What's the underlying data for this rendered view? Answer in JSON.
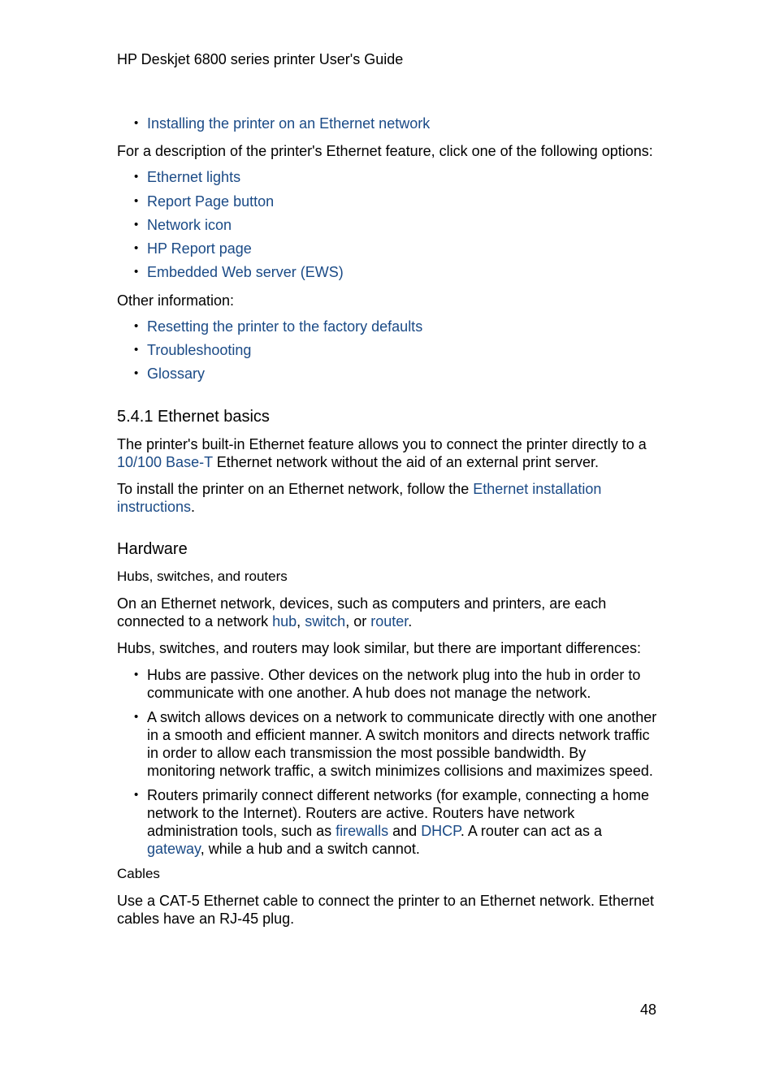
{
  "header": {
    "title": "HP Deskjet 6800 series printer User's Guide"
  },
  "top_links": [
    {
      "label": "Installing the printer on an Ethernet network"
    }
  ],
  "feature_intro": "For a description of the printer's Ethernet feature, click one of the following options:",
  "feature_links": [
    {
      "label": "Ethernet lights"
    },
    {
      "label": "Report Page button"
    },
    {
      "label": "Network icon"
    },
    {
      "label": "HP Report page"
    },
    {
      "label": "Embedded Web server (EWS)"
    }
  ],
  "other_intro": "Other information:",
  "other_links": [
    {
      "label": "Resetting the printer to the factory defaults"
    },
    {
      "label": "Troubleshooting"
    },
    {
      "label": "Glossary"
    }
  ],
  "section": {
    "heading": "5.4.1  Ethernet basics",
    "para1": {
      "pre": "The printer's built-in Ethernet feature allows you to connect the printer directly to a ",
      "link": "10/100 Base-T",
      "post": " Ethernet network without the aid of an external print server."
    },
    "para2": {
      "pre": "To install the printer on an Ethernet network, follow the ",
      "link": "Ethernet installation instructions",
      "post": "."
    }
  },
  "hardware": {
    "heading": "Hardware",
    "subheading": "Hubs, switches, and routers",
    "para1": {
      "pre": "On an Ethernet network, devices, such as computers and printers, are each connected to a network ",
      "link_hub": "hub",
      "sep1": ", ",
      "link_switch": "switch",
      "sep2": ", or ",
      "link_router": "router",
      "post": "."
    },
    "para2": "Hubs, switches, and routers may look similar, but there are important differences:",
    "bullets": {
      "hubs": "Hubs are passive. Other devices on the network plug into the hub in order to communicate with one another. A hub does not manage the network.",
      "switch": "A switch allows devices on a network to communicate directly with one another in a smooth and efficient manner. A switch monitors and directs network traffic in order to allow each transmission the most possible bandwidth. By monitoring network traffic, a switch minimizes collisions and maximizes speed.",
      "routers": {
        "pre": "Routers primarily connect different networks (for example, connecting a home network to the Internet). Routers are active. Routers have network administration tools, such as ",
        "link_firewalls": "firewalls",
        "mid1": " and ",
        "link_dhcp": "DHCP",
        "mid2": ". A router can act as a ",
        "link_gateway": "gateway",
        "post": ", while a hub and a switch cannot."
      }
    },
    "cables_heading": "Cables",
    "cables_text": "Use a CAT-5 Ethernet cable to connect the printer to an Ethernet network. Ethernet cables have an RJ-45 plug."
  },
  "page_number": "48",
  "colors": {
    "link": "#1a4a86",
    "text": "#000000"
  }
}
